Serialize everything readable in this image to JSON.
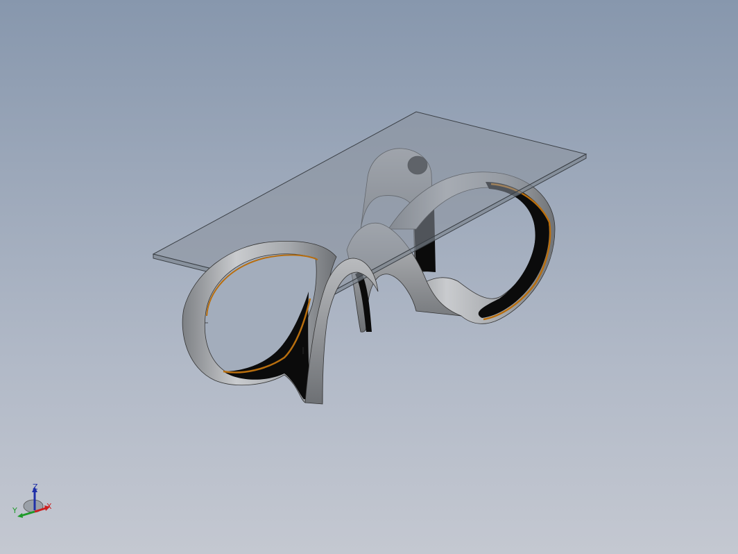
{
  "viewport": {
    "background_top": "#8797ad",
    "background_bottom": "#c4c8d1"
  },
  "model": {
    "name": "glass-top-ribbon-table",
    "glass_color": "#8a929c",
    "metal_color": "#a8aaad",
    "inner_color": "#0a0a0a",
    "accent_color": "#b86e0e"
  },
  "triad": {
    "x_label": "X",
    "y_label": "Y",
    "z_label": "Z",
    "x_color": "#cc1f1f",
    "y_color": "#1f9a2a",
    "z_color": "#1f2fa8"
  }
}
